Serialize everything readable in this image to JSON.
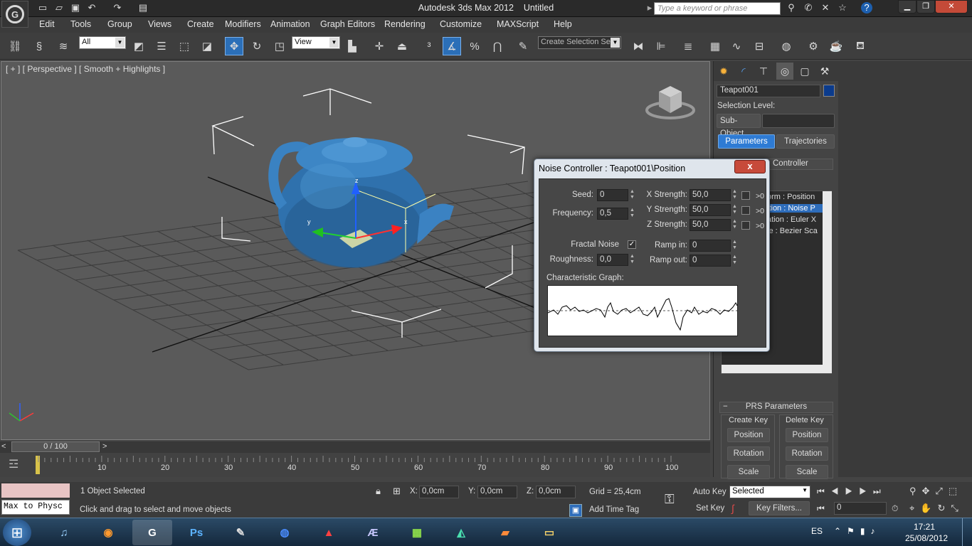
{
  "app": {
    "title": "Autodesk 3ds Max  2012",
    "document": "Untitled",
    "search_placeholder": "Type a keyword or phrase"
  },
  "menu": [
    "Edit",
    "Tools",
    "Group",
    "Views",
    "Create",
    "Modifiers",
    "Animation",
    "Graph Editors",
    "Rendering",
    "Customize",
    "MAXScript",
    "Help"
  ],
  "toolbar": {
    "filter": "All",
    "ref_coord": "View",
    "selection_set": "Create Selection Se"
  },
  "viewport": {
    "label": "[ + ] [ Perspective ] [ Smooth + Highlights ]"
  },
  "command_panel": {
    "object_name": "Teapot001",
    "object_color": "#0b3b8c",
    "selection_level_label": "Selection Level:",
    "sub_object_label": "Sub-Object",
    "tabs": [
      "Parameters",
      "Trajectories"
    ],
    "controller_header": "Controller",
    "controller_items": [
      "orm : Position",
      "ition : Noise P",
      "ation : Euler X",
      "le : Bezier Sca"
    ],
    "prs_header": "PRS Parameters",
    "create_key_label": "Create Key",
    "delete_key_label": "Delete Key",
    "key_buttons": [
      "Position",
      "Rotation",
      "Scale"
    ]
  },
  "dialog": {
    "title": "Noise Controller : Teapot001\\Position",
    "close": "x",
    "seed_label": "Seed:",
    "seed_value": "0",
    "frequency_label": "Frequency:",
    "frequency_value": "0,5",
    "x_strength_label": "X Strength:",
    "x_strength_value": "50,0",
    "y_strength_label": "Y Strength:",
    "y_strength_value": "50,0",
    "z_strength_label": "Z Strength:",
    "z_strength_value": "50,0",
    "gt0_label": ">0",
    "fractal_noise_label": "Fractal Noise",
    "fractal_noise_checked": true,
    "roughness_label": "Roughness:",
    "roughness_value": "0,0",
    "ramp_in_label": "Ramp in:",
    "ramp_in_value": "0",
    "ramp_out_label": "Ramp out:",
    "ramp_out_value": "0",
    "graph_label": "Characteristic Graph:"
  },
  "timeline": {
    "frame_display": "0 / 100",
    "ticks": [
      "10",
      "20",
      "30",
      "40",
      "50",
      "60",
      "70",
      "80",
      "90",
      "100"
    ]
  },
  "status": {
    "maxscript": "Max to Physc",
    "selection": "1 Object Selected",
    "prompt": "Click and drag to select and move objects",
    "x_label": "X:",
    "x_value": "0,0cm",
    "y_label": "Y:",
    "y_value": "0,0cm",
    "z_label": "Z:",
    "z_value": "0,0cm",
    "grid": "Grid = 25,4cm",
    "add_time_tag": "Add Time Tag",
    "auto_key": "Auto Key",
    "set_key": "Set Key",
    "key_mode": "Selected",
    "key_filters": "Key Filters...",
    "frame_field": "0"
  },
  "taskbar": {
    "lang": "ES",
    "time": "17:21",
    "date": "25/08/2012",
    "apps": [
      "iTunes",
      "Firefox",
      "3ds Max",
      "Ps",
      "Sonic",
      "Globe",
      "SBX",
      "AE",
      "Green",
      "AL",
      "Box",
      "Folder"
    ]
  }
}
